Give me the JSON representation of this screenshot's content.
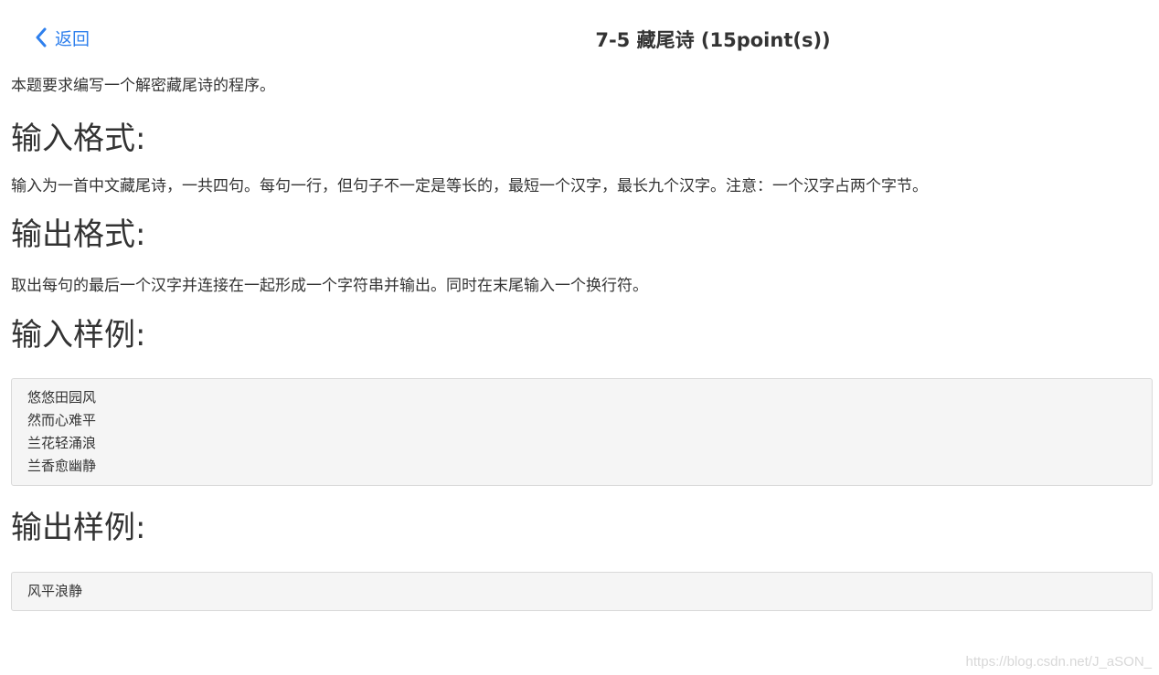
{
  "header": {
    "back_label": "返回",
    "title": "7-5 藏尾诗 (15point(s))"
  },
  "problem": {
    "intro": "本题要求编写一个解密藏尾诗的程序。",
    "input_format": {
      "heading": "输入格式:",
      "text": "输入为一首中文藏尾诗，一共四句。每句一行，但句子不一定是等长的，最短一个汉字，最长九个汉字。注意：一个汉字占两个字节。"
    },
    "output_format": {
      "heading": "输出格式:",
      "text": "取出每句的最后一个汉字并连接在一起形成一个字符串并输出。同时在末尾输入一个换行符。"
    },
    "sample_input": {
      "heading": "输入样例:",
      "lines": [
        "悠悠田园风",
        "然而心难平",
        "兰花轻涌浪",
        "兰香愈幽静"
      ]
    },
    "sample_output": {
      "heading": "输出样例:",
      "lines": [
        "风平浪静"
      ]
    }
  },
  "watermark": "https://blog.csdn.net/J_aSON_",
  "colors": {
    "link": "#2f80ed",
    "code_bg": "#f5f5f5",
    "code_border": "#d9d9d9",
    "text": "#333333"
  },
  "icons": {
    "back": "chevron-left-icon"
  }
}
